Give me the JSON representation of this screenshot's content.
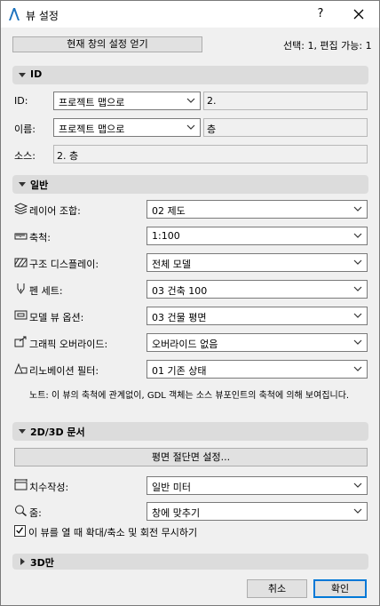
{
  "window": {
    "title": "뷰 설정",
    "help": "?"
  },
  "top": {
    "get_settings_button": "현재 창의 설정 얻기",
    "selection_info": "선택: 1, 편집 가능: 1"
  },
  "sections": {
    "id": "ID",
    "general": "일반",
    "docs": "2D/3D 문서",
    "only3d": "3D만"
  },
  "id_section": {
    "id_label": "ID:",
    "id_combo": "프로젝트 맵으로",
    "id_value": "2.",
    "name_label": "이름:",
    "name_combo": "프로젝트 맵으로",
    "name_value": "층",
    "source_label": "소스:",
    "source_value": "2. 층"
  },
  "general": {
    "rows": [
      {
        "icon": "layer-combo-icon",
        "label": "레이어 조합:",
        "value": "02 제도"
      },
      {
        "icon": "scale-ruler-icon",
        "label": "축척:",
        "value": "1:100"
      },
      {
        "icon": "structure-display-icon",
        "label": "구조 디스플레이:",
        "value": "전체 모델"
      },
      {
        "icon": "pen-set-icon",
        "label": "펜 세트:",
        "value": "03 건축 100"
      },
      {
        "icon": "model-view-icon",
        "label": "모델 뷰 옵션:",
        "value": "03 건물 평면"
      },
      {
        "icon": "graphic-override-icon",
        "label": "그래픽 오버라이드:",
        "value": "오버라이드 없음"
      },
      {
        "icon": "renovation-filter-icon",
        "label": "리노베이션 필터:",
        "value": "01 기존 상태"
      }
    ],
    "note": "노트: 이 뷰의 축척에 관계없이, GDL 객체는 소스 뷰포인트의 축척에 의해 보여집니다."
  },
  "docs": {
    "cut_settings_button": "평면 절단면 설정...",
    "dimension_label": "치수작성:",
    "dimension_value": "일반 미터",
    "zoom_label": "줌:",
    "zoom_value": "창에 맞추기",
    "ignore_zoom_checkbox": "이 뷰를 열 때 확대/축소 및 회전 무시하기",
    "ignore_zoom_checked": true
  },
  "footer": {
    "cancel": "취소",
    "ok": "확인"
  }
}
